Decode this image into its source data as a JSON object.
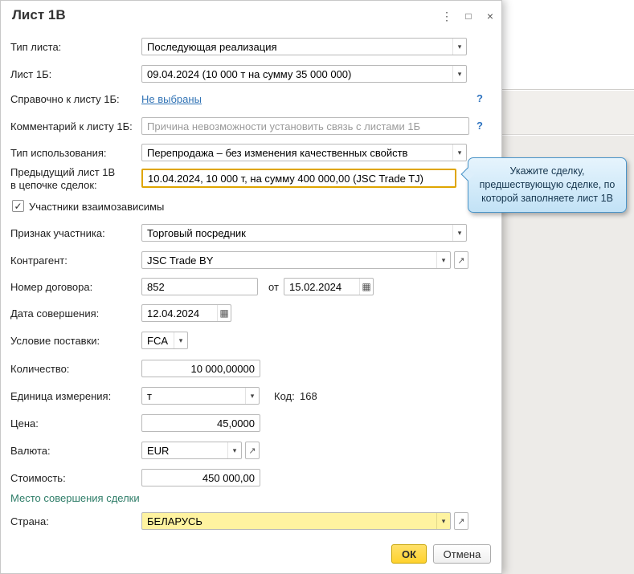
{
  "colors": {
    "accent_yellow": "#ffd22e",
    "highlight_border": "#dfa500",
    "country_field_bg": "#fff3a0",
    "link_blue": "#3173b5",
    "section_green": "#2e7d68",
    "tooltip_border": "#4a94c8"
  },
  "window": {
    "title": "Лист 1В",
    "menu_icon": "⋮",
    "maximize_icon": "□",
    "close_icon": "×"
  },
  "icons": {
    "combo_arrow": "▾",
    "calendar": "▦",
    "open": "↗",
    "check": "✓"
  },
  "form": {
    "sheet_type": {
      "label": "Тип листа:",
      "value": "Последующая реализация"
    },
    "sheet_1b": {
      "label": "Лист 1Б:",
      "value": "09.04.2024 (10 000 т на сумму 35 000 000)"
    },
    "ref_1b": {
      "label": "Справочно к листу 1Б:",
      "link": "Не выбраны",
      "help": "?"
    },
    "comment_1b": {
      "label": "Комментарий к листу 1Б:",
      "placeholder": "Причина невозможности установить связь с листами 1Б",
      "help": "?"
    },
    "usage_type": {
      "label": "Тип использования:",
      "value": "Перепродажа – без изменения качественных свойств"
    },
    "prev_sheet": {
      "label_line1": "Предыдущий лист 1В",
      "label_line2": "в цепочке сделок:",
      "value": "10.04.2024, 10 000 т, на сумму 400 000,00 (JSC Trade TJ)"
    },
    "interdependent": {
      "label": "Участники взаимозависимы"
    },
    "participant_role": {
      "label": "Признак участника:",
      "value": "Торговый посредник"
    },
    "counterparty": {
      "label": "Контрагент:",
      "value": "JSC Trade BY"
    },
    "contract": {
      "label": "Номер договора:",
      "number": "852",
      "from_label": "от",
      "date": "15.02.2024"
    },
    "deal_date": {
      "label": "Дата совершения:",
      "value": "12.04.2024"
    },
    "delivery": {
      "label": "Условие поставки:",
      "value": "FCA"
    },
    "quantity": {
      "label": "Количество:",
      "value": "10 000,00000"
    },
    "unit": {
      "label": "Единица измерения:",
      "value": "т",
      "code_label": "Код:",
      "code_value": "168"
    },
    "price": {
      "label": "Цена:",
      "value": "45,0000"
    },
    "currency": {
      "label": "Валюта:",
      "value": "EUR"
    },
    "cost": {
      "label": "Стоимость:",
      "value": "450 000,00"
    },
    "place_section_title": "Место совершения сделки",
    "country": {
      "label": "Страна:",
      "value": "БЕЛАРУСЬ"
    },
    "buttons": {
      "ok": "ОК",
      "cancel": "Отмена"
    }
  },
  "tooltip": {
    "text": "Укажите сделку, предшествующую сделке, по которой заполняете лист 1В"
  }
}
